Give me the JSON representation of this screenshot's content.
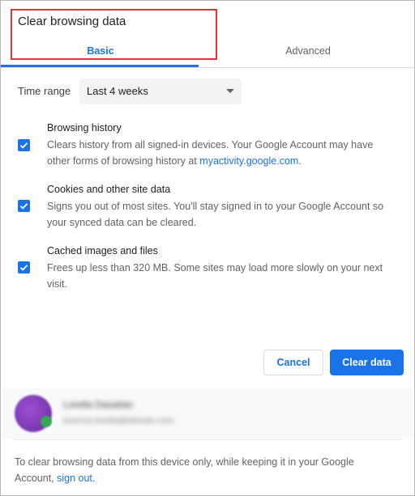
{
  "dialog": {
    "title": "Clear browsing data"
  },
  "tabs": [
    {
      "label": "Basic",
      "active": true
    },
    {
      "label": "Advanced",
      "active": false
    }
  ],
  "time_range": {
    "label": "Time range",
    "value": "Last 4 weeks"
  },
  "options": [
    {
      "title": "Browsing history",
      "checked": true,
      "desc_line1": "Clears history from all signed-in devices. Your Google Account may have",
      "desc_pre_link": "other forms of browsing history at ",
      "link": "myactivity.google.com",
      "desc_post_link": "."
    },
    {
      "title": "Cookies and other site data",
      "checked": true,
      "desc": "Signs you out of most sites. You'll stay signed in to your Google Account so your synced data can be cleared."
    },
    {
      "title": "Cached images and files",
      "checked": true,
      "desc": "Frees up less than 320 MB. Some sites may load more slowly on your next visit."
    }
  ],
  "buttons": {
    "cancel": "Cancel",
    "clear": "Clear data"
  },
  "account": {
    "name": "Lorella Dasalian",
    "email": "lorenza.lorella@dahalo.com"
  },
  "footer": {
    "text": "To clear browsing data from this device only, while keeping it in your Google Account, ",
    "link": "sign out",
    "end": "."
  },
  "colors": {
    "accent": "#1a73e8",
    "highlight_border": "#e0343d"
  }
}
